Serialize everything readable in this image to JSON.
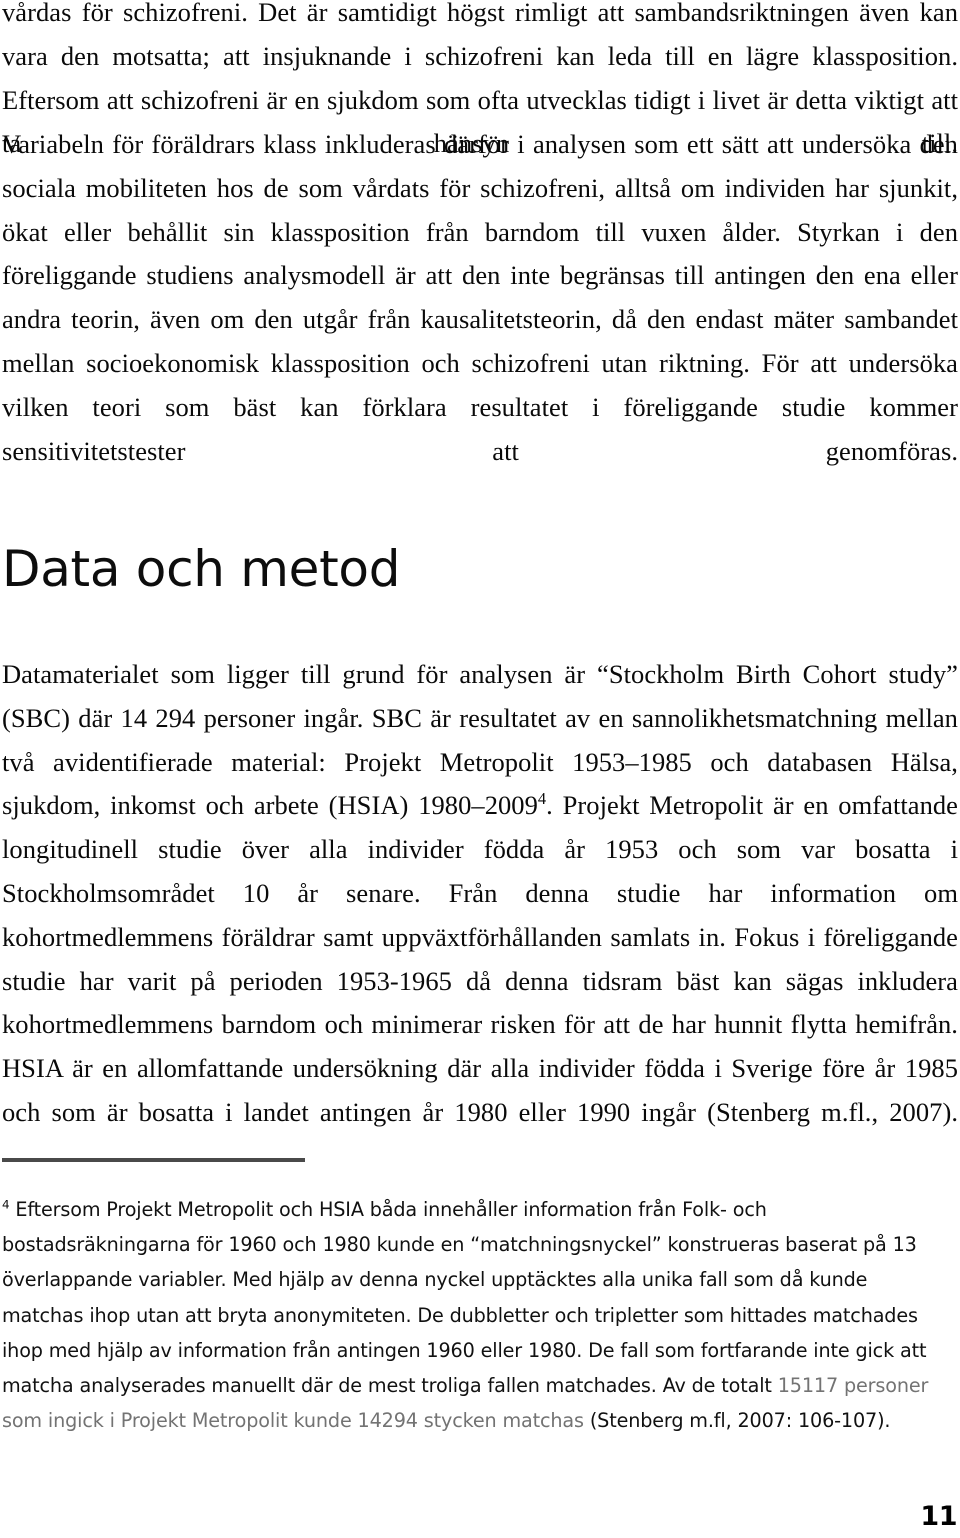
{
  "document": {
    "language": "sv",
    "page_number": "11"
  },
  "body": {
    "paragraph_1_part_a": "vårdas för schizofreni. Det är samtidigt högst rimligt att sambandsriktningen även kan vara den motsatta; att insjuknande i schizofreni kan leda till en lägre klassposition. Eftersom att schizofreni är en sjukdom som ofta utvecklas tidigt i livet är detta viktigt att ta hänsyn till.",
    "paragraph_2": "Variabeln för föräldrars klass inkluderas därför i analysen som ett sätt att undersöka den sociala mobiliteten hos de som vårdats för schizofreni, alltså om individen har sjunkit, ökat eller behållit sin klassposition från barndom till vuxen ålder. Styrkan i den föreliggande studiens analysmodell är att den inte begränsas till antingen den ena eller andra teorin, även om den utgår från kausalitetsteorin, då den endast mäter sambandet mellan socioekonomisk klassposition och schizofreni utan riktning. För att undersöka vilken teori som bäst kan förklara resultatet i föreliggande studie kommer sensitivitetstester att genomföras.",
    "paragraph_3_before_ref": "Datamaterialet som ligger till grund för analysen är “Stockholm Birth Cohort study” (SBC) där 14 294 personer ingår. SBC är resultatet av en sannolikhetsmatchning mellan två avidentifierade material: Projekt Metropolit 1953–1985 och databasen Hälsa, sjukdom, inkomst och arbete (HSIA) 1980–2009",
    "paragraph_3_footnote_marker": "4",
    "paragraph_3_after_ref": ". Projekt Metropolit är en omfattande longitudinell studie över alla individer födda år 1953 och som var bosatta i Stockholmsområdet 10 år senare. Från denna studie har information om kohortmedlemmens föräldrar samt uppväxtförhållanden samlats in. Fokus i föreliggande studie har varit på perioden 1953-1965 då denna tidsram bäst kan sägas inkludera kohortmedlemmens barndom och minimerar risken för att de har hunnit flytta hemifrån. HSIA är en allomfattande undersökning där alla individer födda i Sverige före år 1985 och som är bosatta i landet antingen år 1980 eller 1990 ingår (Stenberg m.fl., 2007)."
  },
  "heading": {
    "text": "Data och metod"
  },
  "footnote": {
    "marker": "4",
    "text_part_1": " Eftersom Projekt Metropolit och HSIA båda innehåller information från Folk- och bostadsräkningarna för 1960 och 1980 kunde en “matchningsnyckel” konstrueras baserat på 13 överlappande variabler. Med hjälp av denna nyckel upptäcktes alla unika fall som då kunde matchas ihop utan att bryta anonymiteten. De dubbletter och tripletter som hittades matchades ihop med hjälp av information från antingen 1960 eller 1980. De fall som fortfarande inte gick att matcha analyserades manuellt där de mest troliga fallen matchades. Av de totalt ",
    "text_highlighted": "15117 personer som ingick i Projekt Metropolit kunde 14294 stycken matchas",
    "text_part_2": " (Stenberg m.fl, 2007: 106-107)."
  },
  "colors": {
    "text": "#0a0a0a",
    "footnote_gray": "#737373",
    "rule": "#4a4a4a",
    "background": "#ffffff"
  }
}
